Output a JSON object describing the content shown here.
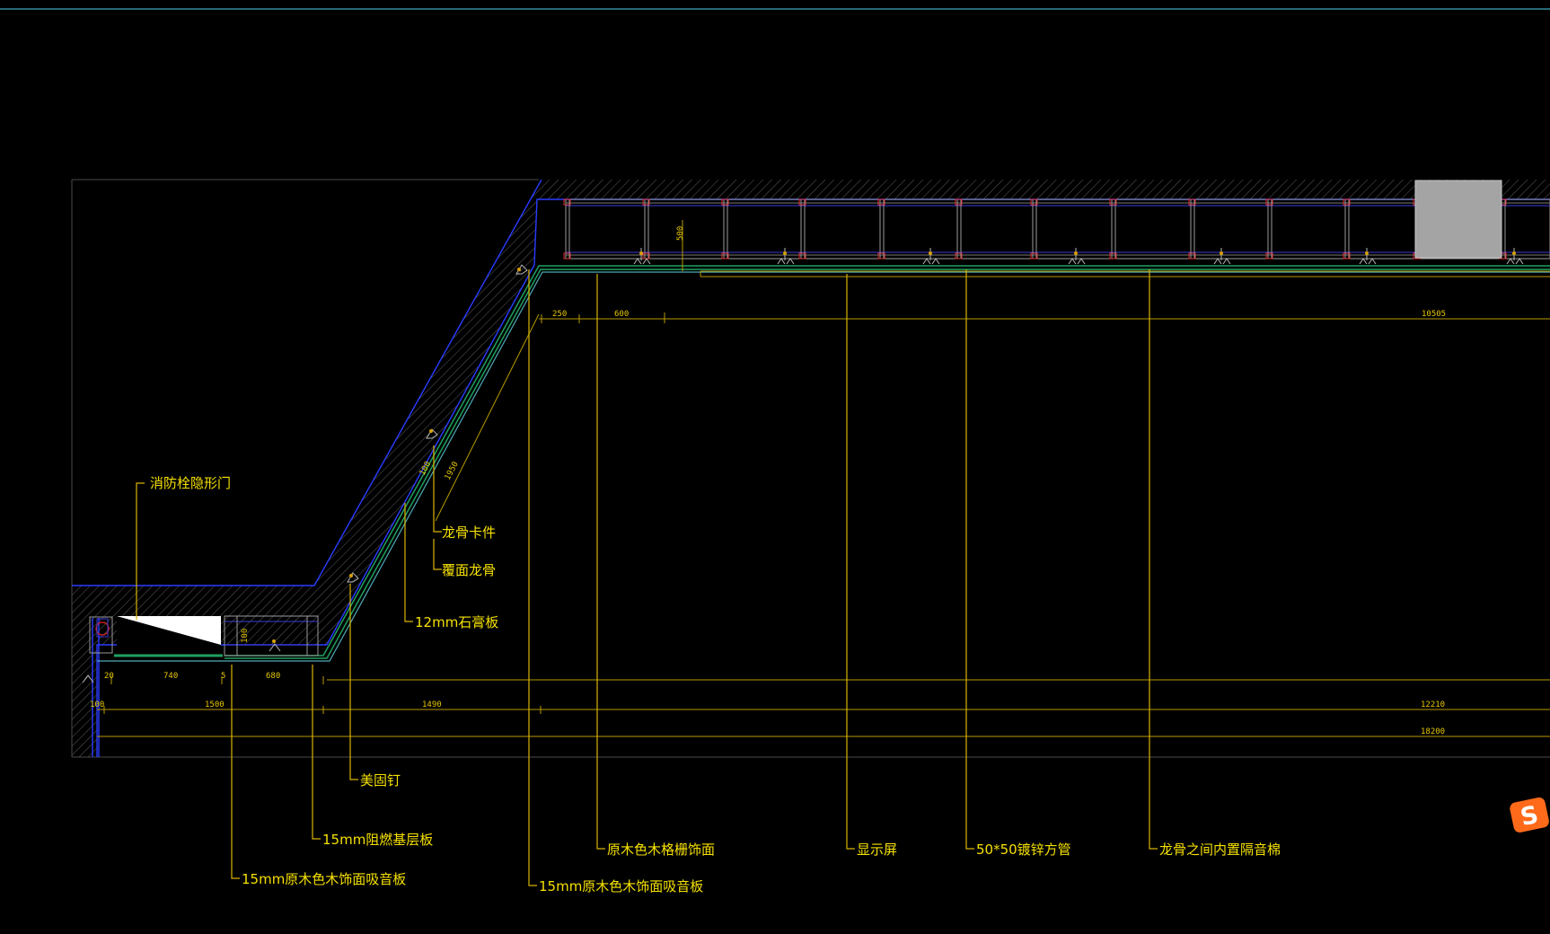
{
  "labels": {
    "fire_hydrant_door": "消防栓隐形门",
    "keel_clip": "龙骨卡件",
    "cover_keel": "覆面龙骨",
    "gypsum_12": "12mm石膏板",
    "meigu_nail": "美固钉",
    "fire_retardant_base": "15mm阻燃基层板",
    "wood_acoustic_left": "15mm原木色木饰面吸音板",
    "wood_grille": "原木色木格栅饰面",
    "wood_acoustic_center": "15mm原木色木饰面吸音板",
    "display_screen": "显示屏",
    "square_tube": "50*50镀锌方管",
    "soundproof_cotton": "龙骨之间内置隔音棉"
  },
  "dimensions": {
    "top_250": "250",
    "top_600": "600",
    "top_10505": "10505",
    "upper_500": "500",
    "slope_100": "100",
    "slope_1950": "1950",
    "box_100": "100",
    "low_20": "20",
    "low_740": "740",
    "low_5": "5",
    "low_680": "680",
    "row_100": "100",
    "row_1500": "1500",
    "row_1490": "1490",
    "row_12210": "12210",
    "total_18200": "18200"
  },
  "icons": {
    "watermark": "sogou-s-logo"
  },
  "colors": {
    "background": "#000000",
    "label": "#f5e000",
    "wall_outline": "#2a3cff",
    "finish_layer": "#1fa060",
    "gray_panel": "#a4a4a4",
    "top_rule": "#3fa8c0",
    "watermark": "#ff6a1a"
  }
}
